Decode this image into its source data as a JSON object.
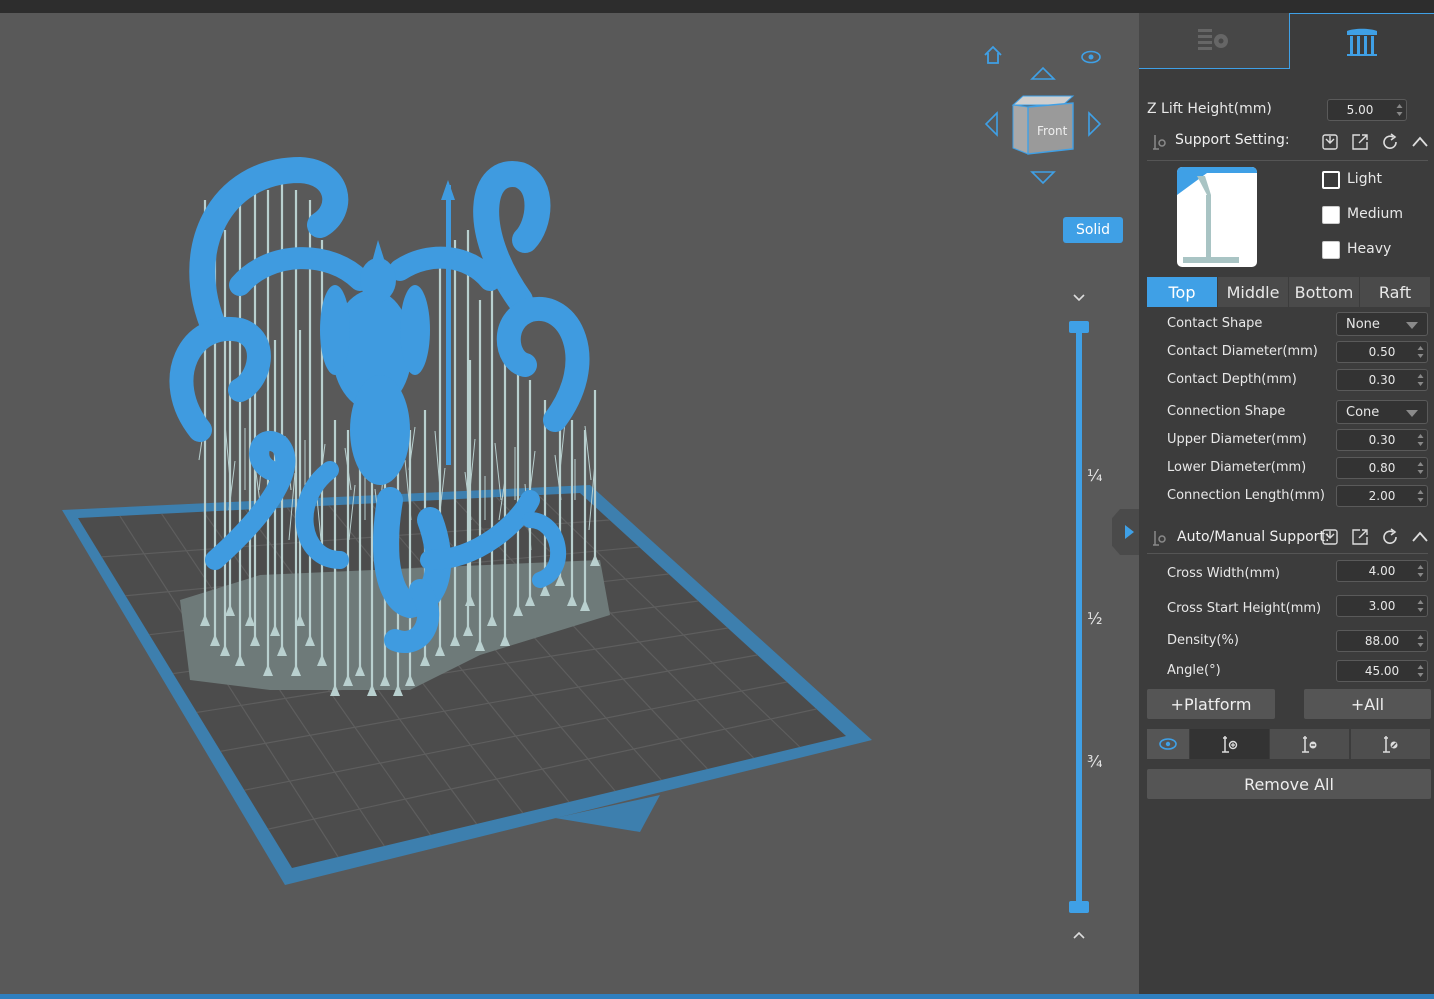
{
  "viewport": {
    "view_mode_label": "Solid",
    "view_cube_label": "Front",
    "layer_marks": [
      "¼",
      "½",
      "¾"
    ],
    "icons": [
      "home-icon",
      "eye-icon",
      "arrow-up-icon",
      "arrow-down-icon",
      "arrow-left-icon",
      "arrow-right-icon",
      "chevron-up-icon",
      "chevron-down-icon",
      "chevron-right-icon"
    ],
    "accent_color": "#3fa0e6",
    "model_color": "#3f9be0",
    "support_color": "#b9d0cf"
  },
  "panel": {
    "tabs": [
      {
        "name": "settings-tab",
        "icon": "list-gear-icon"
      },
      {
        "name": "support-tab",
        "icon": "support-columns-icon"
      }
    ],
    "z_lift": {
      "label": "Z Lift Height(mm)",
      "value": "5.00"
    },
    "support_setting": {
      "title": "Support Setting:",
      "presets": [
        {
          "label": "Light",
          "checked": true
        },
        {
          "label": "Medium",
          "checked": false
        },
        {
          "label": "Heavy",
          "checked": false
        }
      ],
      "tabs": [
        "Top",
        "Middle",
        "Bottom",
        "Raft"
      ],
      "active_tab": "Top",
      "fields": {
        "contact_shape": {
          "label": "Contact Shape",
          "value": "None"
        },
        "contact_diameter": {
          "label": "Contact Diameter(mm)",
          "value": "0.50"
        },
        "contact_depth": {
          "label": "Contact Depth(mm)",
          "value": "0.30"
        },
        "connection_shape": {
          "label": "Connection Shape",
          "value": "Cone"
        },
        "upper_diameter": {
          "label": "Upper Diameter(mm)",
          "value": "0.30"
        },
        "lower_diameter": {
          "label": "Lower Diameter(mm)",
          "value": "0.80"
        },
        "connection_length": {
          "label": "Connection Length(mm)",
          "value": "2.00"
        }
      }
    },
    "auto_manual": {
      "title": "Auto/Manual Support:",
      "fields": {
        "cross_width": {
          "label": "Cross Width(mm)",
          "value": "4.00"
        },
        "cross_start_height": {
          "label": "Cross Start Height(mm)",
          "value": "3.00"
        },
        "density": {
          "label": "Density(%)",
          "value": "88.00"
        },
        "angle": {
          "label": "Angle(°)",
          "value": "45.00"
        }
      }
    },
    "buttons": {
      "platform": "+Platform",
      "all": "+All",
      "remove_all": "Remove All"
    }
  }
}
